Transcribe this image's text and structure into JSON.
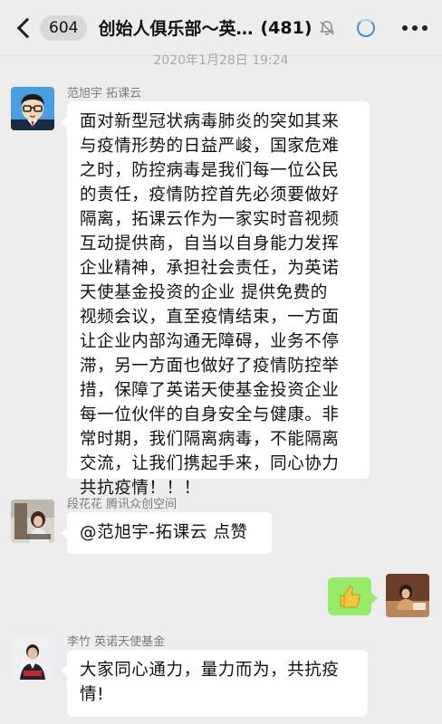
{
  "header": {
    "unread_count": "604",
    "title": "创始人俱乐部～英…",
    "member_count": "(481)"
  },
  "timestamp": "2020年1月28日 19:24",
  "messages": [
    {
      "sender": "范旭宇  拓课云",
      "lines": [
        "面对新型冠状病毒肺炎的突如其来",
        "与疫情形势的日益严峻，国家危难",
        "之时，防控病毒是我们每一位公民",
        "的责任，疫情防控首先必须要做好",
        "隔离，拓课云作为一家实时音视频",
        "互动提供商，自当以自身能力发挥",
        "企业精神，承担社会责任，为英诺",
        "天使基金投资的企业 提供免费的",
        "视频会议，直至疫情结束，一方面",
        "让企业内部沟通无障碍，业务不停",
        "滞，另一方面也做好了疫情防控举",
        "措，保障了英诺天使基金投资企业",
        "每一位伙伴的自身安全与健康。非",
        "常时期，我们隔离病毒，不能隔离",
        "交流，让我们携起手来，同心协力",
        "共抗疫情！！！"
      ]
    },
    {
      "sender": "段花花  腾讯众创空间",
      "lines": [
        "@范旭宇-拓课云 点赞"
      ]
    },
    {
      "sender": "",
      "sticker": "thumbs-up"
    },
    {
      "sender": "李竹  英诺天使基金",
      "lines": [
        "大家同心通力，量力而为，共抗疫",
        "情!"
      ]
    }
  ],
  "colors": {
    "background": "#ededed",
    "bubble_white": "#ffffff",
    "bubble_green": "#95ec69",
    "loading_blue": "#3b8fd9"
  },
  "icons": {
    "back": "chevron-left-icon",
    "mute": "bell-off-icon",
    "loading": "loading-circle-icon",
    "more": "more-dots-icon",
    "thumbs_up": "thumbs-up-icon"
  }
}
